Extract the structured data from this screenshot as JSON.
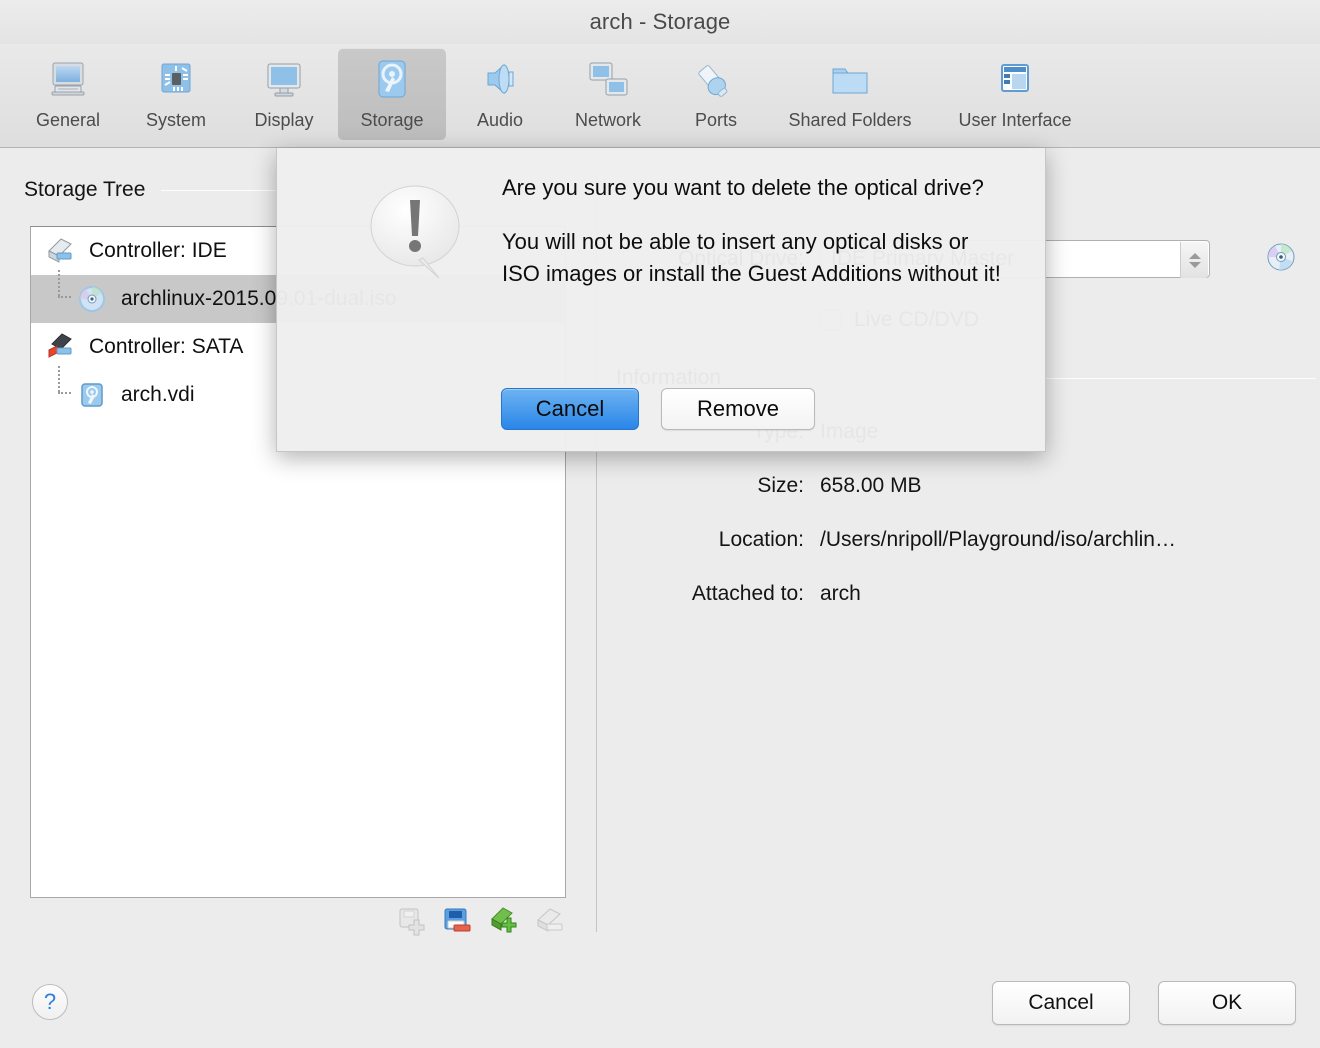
{
  "window": {
    "title": "arch - Storage"
  },
  "toolbar": {
    "items": [
      {
        "label": "General",
        "icon": "monitor-icon",
        "selected": false
      },
      {
        "label": "System",
        "icon": "motherboard-icon",
        "selected": false
      },
      {
        "label": "Display",
        "icon": "display-icon",
        "selected": false
      },
      {
        "label": "Storage",
        "icon": "harddisk-icon",
        "selected": true
      },
      {
        "label": "Audio",
        "icon": "speaker-icon",
        "selected": false
      },
      {
        "label": "Network",
        "icon": "network-icon",
        "selected": false
      },
      {
        "label": "Ports",
        "icon": "ports-icon",
        "selected": false
      },
      {
        "label": "Shared Folders",
        "icon": "folder-icon",
        "selected": false
      },
      {
        "label": "User Interface",
        "icon": "window-layout-icon",
        "selected": false
      }
    ]
  },
  "storage_tree": {
    "header": "Storage Tree",
    "rows": [
      {
        "label": "Controller: IDE",
        "icon": "ide-controller-icon",
        "level": 0,
        "selected": false
      },
      {
        "label": "archlinux-2015.09.01-dual.iso",
        "icon": "cd-disc-icon",
        "level": 1,
        "selected": true
      },
      {
        "label": "Controller: SATA",
        "icon": "sata-controller-icon",
        "level": 0,
        "selected": false
      },
      {
        "label": "arch.vdi",
        "icon": "harddisk-small-icon",
        "level": 1,
        "selected": false
      }
    ],
    "actions": [
      {
        "name": "add-controller-button",
        "icon": "add-controller-icon",
        "enabled": false
      },
      {
        "name": "remove-controller-button",
        "icon": "remove-controller-icon",
        "enabled": true
      },
      {
        "name": "add-attachment-button",
        "icon": "add-attachment-icon",
        "enabled": true
      },
      {
        "name": "remove-attachment-button",
        "icon": "remove-attachment-icon",
        "enabled": false
      }
    ]
  },
  "attributes": {
    "optical_drive_label": "Optical Drive:",
    "optical_drive_value": "IDE Primary Master",
    "live_cd_label": "Live CD/DVD",
    "information_header": "Information",
    "type_label": "Type:",
    "type_value": "Image",
    "size_label": "Size:",
    "size_value": "658.00 MB",
    "location_label": "Location:",
    "location_value": "/Users/nripoll/Playground/iso/archlin…",
    "attached_label": "Attached to:",
    "attached_value": "arch"
  },
  "dialog": {
    "paragraph1": "Are you sure you want to delete the optical drive?",
    "paragraph2": "You will not be able to insert any optical disks or ISO images or install the Guest Additions without it!",
    "cancel_label": "Cancel",
    "remove_label": "Remove",
    "icon": "warning-bubble-icon"
  },
  "footer": {
    "help_label": "?",
    "cancel_label": "Cancel",
    "ok_label": "OK"
  },
  "colors": {
    "accent_blue": "#2a86e8",
    "window_bg": "#ececec",
    "selection_gray": "#c8c8c8"
  }
}
